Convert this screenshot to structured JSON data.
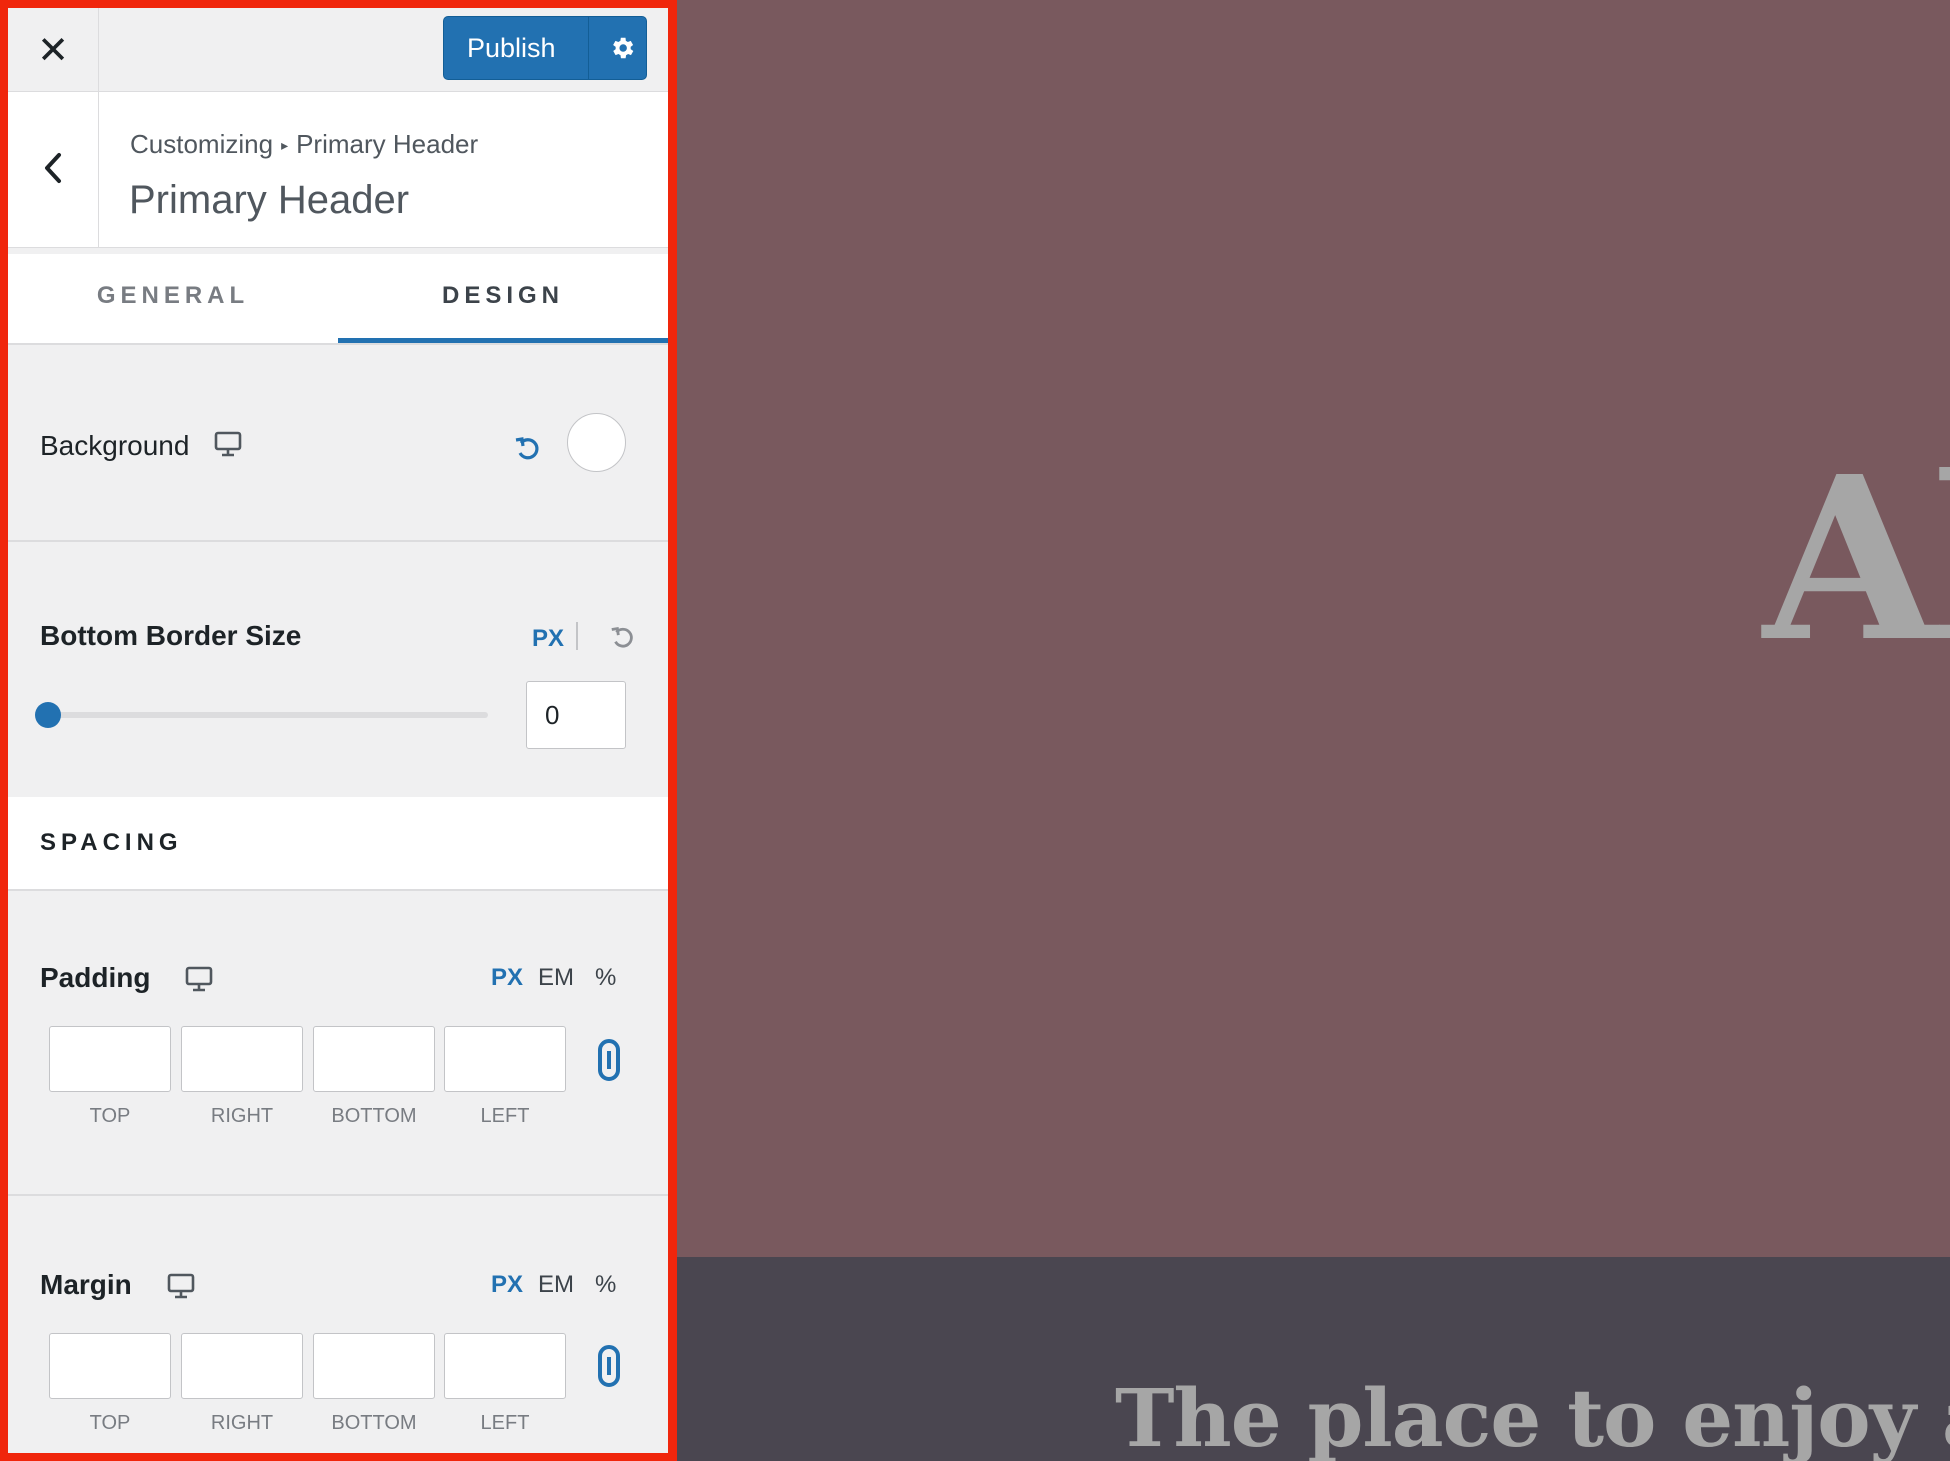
{
  "topbar": {
    "close_symbol": "✕",
    "publish_label": "Publish"
  },
  "section": {
    "breadcrumb_root": "Customizing",
    "breadcrumb_separator": "▸",
    "breadcrumb_current": "Primary Header",
    "title": "Primary Header"
  },
  "tabs": [
    {
      "label": "GENERAL",
      "active": false
    },
    {
      "label": "DESIGN",
      "active": true
    }
  ],
  "background": {
    "label": "Background",
    "color": "#ffffff"
  },
  "bottom_border": {
    "label": "Bottom Border Size",
    "unit": "PX",
    "value": "0",
    "slider_fraction": 0
  },
  "spacing": {
    "heading": "SPACING"
  },
  "padding": {
    "label": "Padding",
    "units": [
      "PX",
      "EM",
      "%"
    ],
    "active_unit": "PX",
    "sides": [
      "TOP",
      "RIGHT",
      "BOTTOM",
      "LEFT"
    ]
  },
  "margin": {
    "label": "Margin",
    "units": [
      "PX",
      "EM",
      "%"
    ],
    "active_unit": "PX",
    "sides": [
      "TOP",
      "RIGHT",
      "BOTTOM",
      "LEFT"
    ]
  },
  "preview": {
    "title_fragment": "Al",
    "tagline_fragment": "The place to enjoy a"
  },
  "colors": {
    "accent": "#2271b1",
    "highlight_border": "#f0260c",
    "hero_background": "#79595e",
    "band_background": "#4a4650"
  },
  "icons": {
    "gear": "gear-icon",
    "back": "chevron-left-icon",
    "device": "desktop-icon",
    "reset": "undo-icon",
    "link": "link-icon"
  }
}
